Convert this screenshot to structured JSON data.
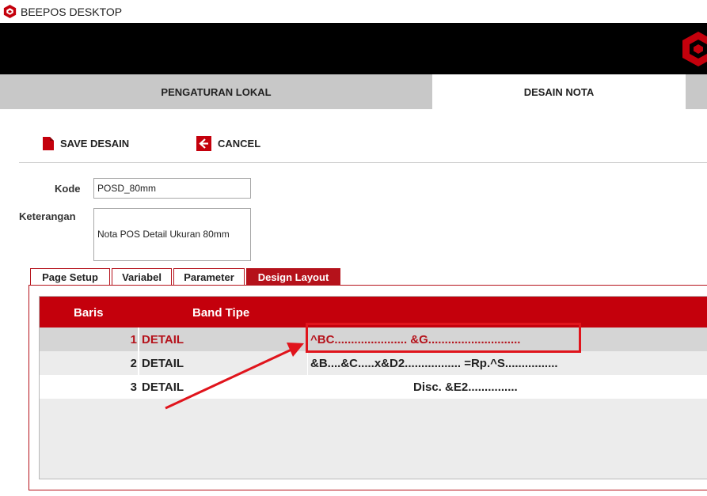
{
  "app": {
    "title": "BEEPOS DESKTOP"
  },
  "main_tabs": [
    {
      "label": "PENGATURAN LOKAL",
      "active": false
    },
    {
      "label": "DESAIN NOTA",
      "active": true
    }
  ],
  "toolbar": {
    "save_label": "SAVE DESAIN",
    "cancel_label": "CANCEL"
  },
  "form": {
    "kode_label": "Kode",
    "kode_value": "POSD_80mm",
    "keterangan_label": "Keterangan",
    "keterangan_value": "Nota POS Detail Ukuran 80mm"
  },
  "sub_tabs": [
    {
      "label": "Page Setup",
      "active": false
    },
    {
      "label": "Variabel",
      "active": false
    },
    {
      "label": "Parameter",
      "active": false
    },
    {
      "label": "Design Layout",
      "active": true
    }
  ],
  "grid": {
    "columns": [
      "Baris",
      "Band Tipe"
    ],
    "rows": [
      {
        "baris": "1",
        "band": "DETAIL",
        "layout": "^BC...................... &G............................",
        "selected": true
      },
      {
        "baris": "2",
        "band": "DETAIL",
        "layout": "&B....&C.....x&D2................. =Rp.^S................",
        "selected": false
      },
      {
        "baris": "3",
        "band": "DETAIL",
        "layout": "Disc.  &E2...............",
        "selected": false
      }
    ]
  },
  "colors": {
    "accent": "#b5121b",
    "header_red": "#c4000c",
    "annotation_red": "#e0141c"
  }
}
